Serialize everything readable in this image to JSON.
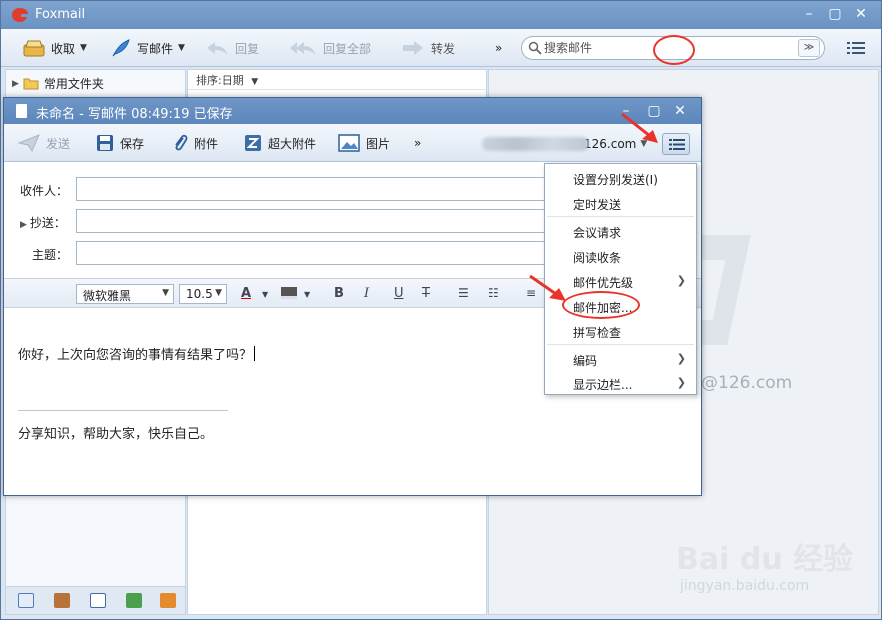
{
  "main_window": {
    "title": "Foxmail",
    "toolbar": {
      "receive": "收取",
      "compose": "写邮件",
      "reply": "回复",
      "reply_all": "回复全部",
      "forward": "转发",
      "more": "»",
      "search_placeholder": "搜索邮件"
    },
    "folder_pane": {
      "folder": "常用文件夹"
    },
    "list_pane": {
      "sort_label": "排序:日期"
    },
    "reading_pane": {
      "account_watermark": "@126.com"
    }
  },
  "compose_window": {
    "title": "未命名 - 写邮件   08:49:19 已保存",
    "toolbar": {
      "send": "发送",
      "save": "保存",
      "attach": "附件",
      "big_attach": "超大附件",
      "image": "图片",
      "more": "»",
      "sender_domain": "126.com"
    },
    "fields": {
      "to_label": "收件人：",
      "cc_label": "抄送：",
      "subject_label": "主题："
    },
    "format_bar": {
      "font": "微软雅黑",
      "size": "10.5"
    },
    "body": {
      "greeting": "你好，上次向您咨询的事情有结果了吗？",
      "signature": "分享知识，帮助大家，快乐自己。"
    }
  },
  "dropdown_menu": {
    "items": [
      {
        "label": "设置分别发送(I)"
      },
      {
        "label": "定时发送"
      },
      {
        "label": "会议请求"
      },
      {
        "label": "阅读收条"
      },
      {
        "label": "邮件优先级"
      },
      {
        "label": "邮件加密..."
      },
      {
        "label": "拼写检查"
      },
      {
        "label": "编码"
      },
      {
        "label": "显示边栏..."
      }
    ]
  },
  "watermark": {
    "logo": "Bai du 经验",
    "url": "jingyan.baidu.com"
  },
  "colors": {
    "title_bar": "#6a92c2",
    "highlight_red": "#e8352b",
    "toolbar_bg": "#dde7f3"
  }
}
